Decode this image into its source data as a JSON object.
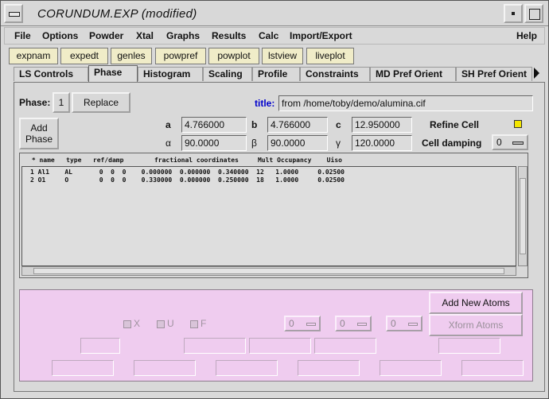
{
  "window": {
    "title": "CORUNDUM.EXP (modified)"
  },
  "menubar": {
    "items": [
      "File",
      "Options",
      "Powder",
      "Xtal",
      "Graphs",
      "Results",
      "Calc",
      "Import/Export"
    ],
    "help": "Help"
  },
  "toolbar": {
    "buttons": [
      "expnam",
      "expedt",
      "genles",
      "powpref",
      "powplot",
      "lstview",
      "liveplot"
    ],
    "button_color": "#f0ecc8"
  },
  "tabs": {
    "items": [
      "LS Controls",
      "Phase",
      "Histogram",
      "Scaling",
      "Profile",
      "Constraints",
      "MD Pref Orient",
      "SH Pref Orient"
    ],
    "active": "Phase"
  },
  "phase": {
    "label": "Phase:",
    "number": "1",
    "replace_label": "Replace",
    "add_phase_line1": "Add",
    "add_phase_line2": "Phase",
    "title_label": "title:",
    "title_value": "from /home/toby/demo/alumina.cif",
    "title_color": "#0000cc"
  },
  "cell": {
    "a_label": "a",
    "a": "4.766000",
    "b_label": "b",
    "b": "4.766000",
    "c_label": "c",
    "c": "12.950000",
    "alpha_label": "α",
    "alpha": "90.0000",
    "beta_label": "β",
    "beta": "90.0000",
    "gamma_label": "γ",
    "gamma": "120.0000",
    "refine_label": "Refine Cell",
    "refine_checked": true,
    "damping_label": "Cell damping",
    "damping_value": "0"
  },
  "atoms": {
    "header": " * name   type   ref/damp        fractional coordinates     Mult Occupancy    Uiso",
    "rows": [
      "1 Al1    AL       0  0  0    0.000000  0.000000  0.340000  12   1.0000     0.02500",
      "2 O1     O        0  0  0    0.330000  0.000000  0.250000  18   1.0000     0.02500"
    ]
  },
  "edit": {
    "add_new_atoms": "Add New Atoms",
    "xform_atoms": "Xform Atoms",
    "check_x": "X",
    "check_u": "U",
    "check_f": "F",
    "damp_values": [
      "0",
      "0",
      "0"
    ],
    "background_color": "#efccef"
  }
}
